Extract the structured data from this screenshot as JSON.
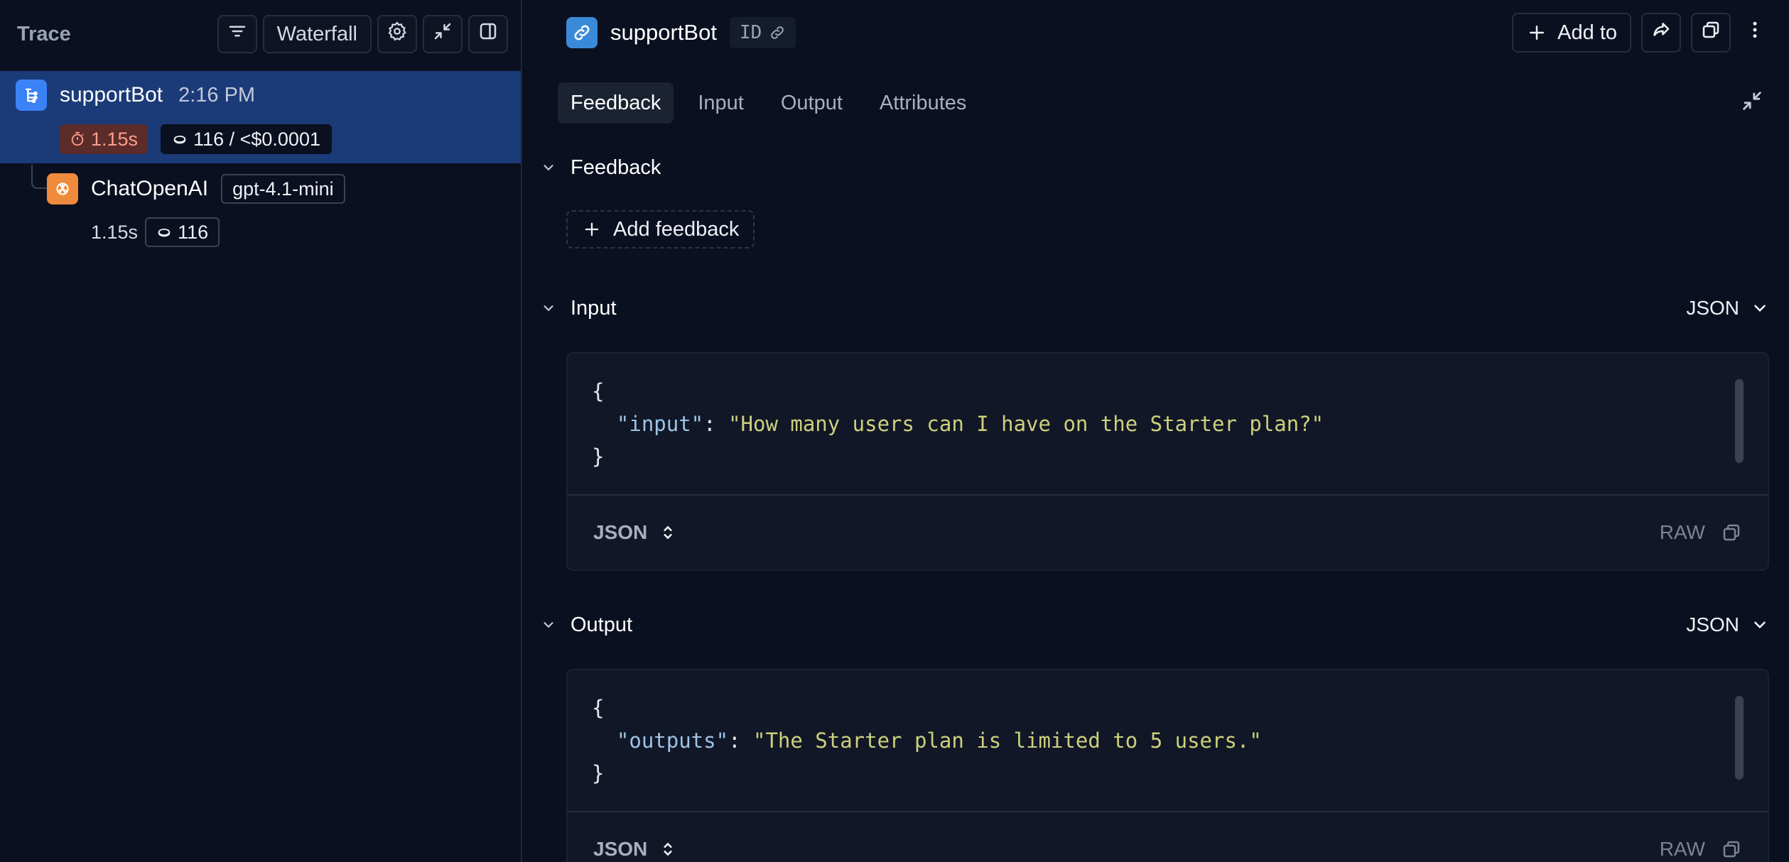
{
  "trace_panel": {
    "title": "Trace",
    "toolbar": {
      "filter_icon": "filter-lines-icon",
      "view_label": "Waterfall",
      "settings_icon": "gear-icon",
      "collapse_icon": "collapse-arrows-icon",
      "panel_icon": "sidebar-panel-icon"
    },
    "nodes": [
      {
        "name": "supportBot",
        "time": "2:16 PM",
        "icon": "chain-icon",
        "latency": "1.15s",
        "tokens_cost": "116 / <$0.0001",
        "selected": true
      },
      {
        "name": "ChatOpenAI",
        "model_tag": "gpt-4.1-mini",
        "icon": "openai-icon",
        "latency": "1.15s",
        "tokens": "116",
        "selected": false
      }
    ]
  },
  "detail": {
    "title": "supportBot",
    "id_label": "ID",
    "add_to_label": "Add to",
    "tabs": [
      "Feedback",
      "Input",
      "Output",
      "Attributes"
    ],
    "active_tab": "Feedback",
    "feedback": {
      "section_title": "Feedback",
      "add_button": "Add feedback"
    },
    "input": {
      "section_title": "Input",
      "format": "JSON",
      "open_brace": "{",
      "close_brace": "}",
      "key": "\"input\"",
      "colon": ": ",
      "value": "\"How many users can I have on the Starter plan?\"",
      "footer_format": "JSON",
      "raw_label": "RAW"
    },
    "output": {
      "section_title": "Output",
      "format": "JSON",
      "open_brace": "{",
      "close_brace": "}",
      "key": "\"outputs\"",
      "colon": ": ",
      "value": "\"The Starter plan is limited to 5 users.\"",
      "footer_format": "JSON",
      "raw_label": "RAW"
    }
  },
  "colors": {
    "background": "#0b1020",
    "selected_row": "#1b3a78",
    "chain_icon": "#3b82f6",
    "llm_icon": "#f08a3c",
    "json_key": "#9cc3e6",
    "json_string": "#cdd07c"
  }
}
